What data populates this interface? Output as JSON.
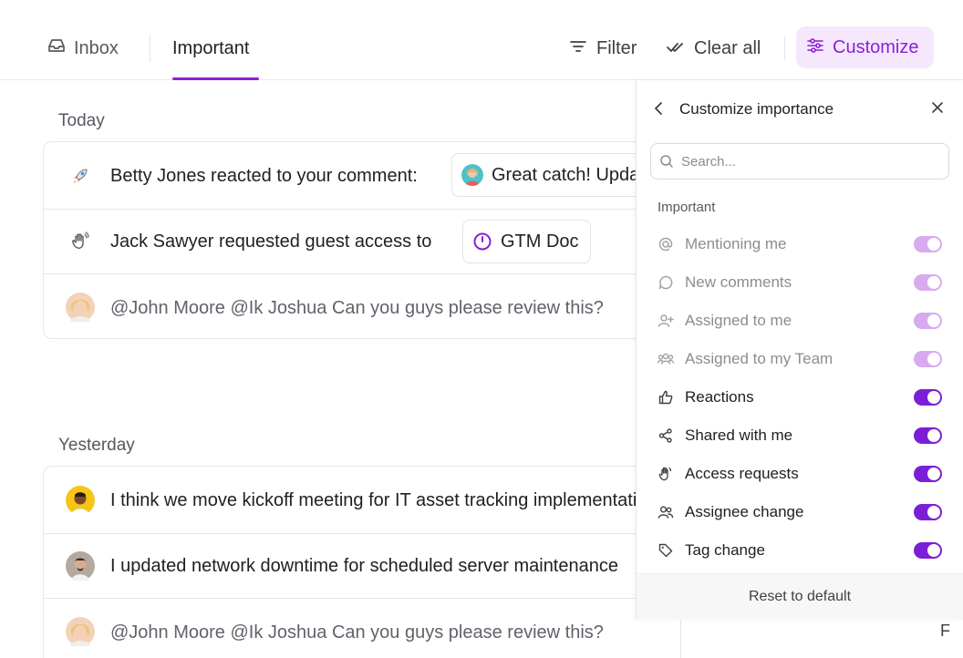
{
  "tabs": {
    "inbox_label": "Inbox",
    "important_label": "Important"
  },
  "toolbar": {
    "filter_label": "Filter",
    "clear_all_label": "Clear all",
    "customize_label": "Customize"
  },
  "colors": {
    "accent": "#8c1ed8",
    "accent_bg": "#f5e8fd",
    "toggle_on": "#7b1fd6",
    "toggle_disabled": "#d8aaf0"
  },
  "feed": {
    "today_label": "Today",
    "yesterday_label": "Yesterday",
    "today_items": [
      {
        "icon": "rocket-icon",
        "text": "Betty Jones reacted to your comment:",
        "chip": "Great catch! Update this"
      },
      {
        "icon": "wave-hand-icon",
        "actor": "Jack Sawyer",
        "text": "requested guest access to",
        "chip": "GTM Doc"
      },
      {
        "icon": "avatar",
        "text": "@John Moore @Ik Joshua Can you guys please review this?"
      }
    ],
    "yesterday_items": [
      {
        "icon": "avatar",
        "text": "I think we move kickoff meeting for IT asset tracking implementation"
      },
      {
        "icon": "avatar",
        "text": "I updated network downtime for scheduled server maintenance"
      },
      {
        "icon": "avatar",
        "text": "@John Moore @Ik Joshua Can you guys please review this?"
      }
    ],
    "cutoff_text": "F"
  },
  "panel": {
    "title": "Customize importance",
    "search_placeholder": "Search...",
    "group_label": "Important",
    "options": [
      {
        "icon": "at-icon",
        "label": "Mentioning me",
        "enabled": true,
        "locked": true
      },
      {
        "icon": "comment-icon",
        "label": "New comments",
        "enabled": true,
        "locked": true
      },
      {
        "icon": "assign-user-icon",
        "label": "Assigned to me",
        "enabled": true,
        "locked": true
      },
      {
        "icon": "team-icon",
        "label": "Assigned to my Team",
        "enabled": true,
        "locked": true
      },
      {
        "icon": "thumbs-up-icon",
        "label": "Reactions",
        "enabled": true,
        "locked": false
      },
      {
        "icon": "share-icon",
        "label": "Shared with me",
        "enabled": true,
        "locked": false
      },
      {
        "icon": "hand-icon",
        "label": "Access requests",
        "enabled": true,
        "locked": false
      },
      {
        "icon": "assignee-change-icon",
        "label": "Assignee change",
        "enabled": true,
        "locked": false
      },
      {
        "icon": "tag-icon",
        "label": "Tag change",
        "enabled": true,
        "locked": false
      }
    ],
    "reset_label": "Reset to default"
  }
}
